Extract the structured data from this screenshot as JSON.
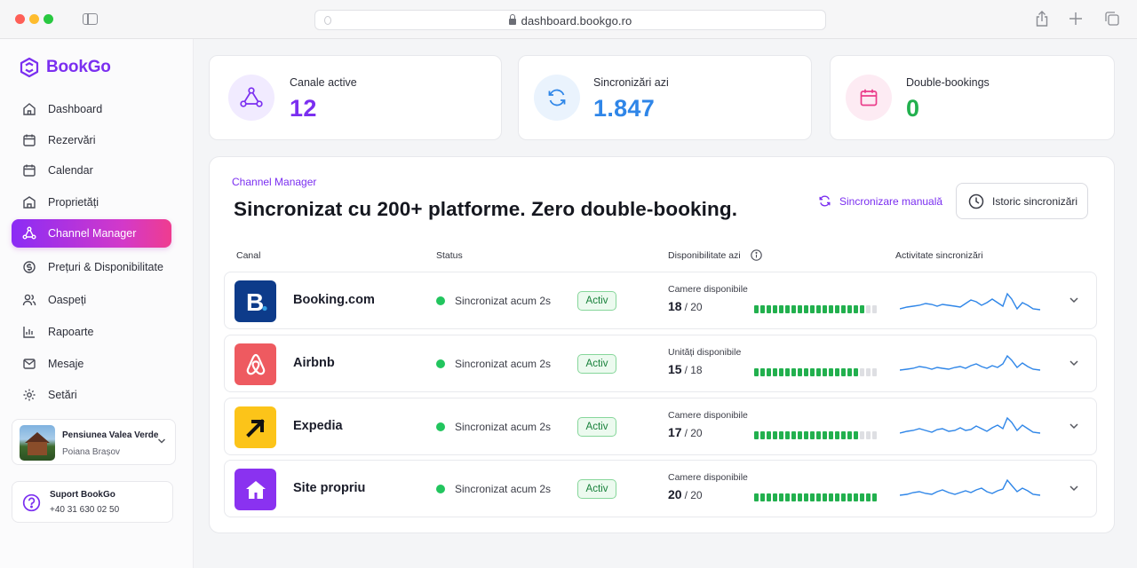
{
  "browser": {
    "url": "dashboard.bookgo.ro"
  },
  "brand": {
    "name": "BookGo"
  },
  "sidebar": {
    "items": [
      {
        "label": "Dashboard",
        "icon": "home-icon",
        "active": false
      },
      {
        "label": "Rezervări",
        "icon": "calendar-icon",
        "active": false
      },
      {
        "label": "Calendar",
        "icon": "calendar-grid-icon",
        "active": false
      },
      {
        "label": "Proprietăți",
        "icon": "building-icon",
        "active": false
      },
      {
        "label": "Channel Manager",
        "icon": "share-nodes-icon",
        "active": true
      },
      {
        "label": "Prețuri & Disponibilitate",
        "icon": "price-tag-icon",
        "active": false
      },
      {
        "label": "Oaspeți",
        "icon": "users-icon",
        "active": false
      },
      {
        "label": "Rapoarte",
        "icon": "bar-chart-icon",
        "active": false
      },
      {
        "label": "Mesaje",
        "icon": "mail-icon",
        "active": false
      },
      {
        "label": "Setări",
        "icon": "gear-icon",
        "active": false
      }
    ],
    "property": {
      "name": "Pensiunea Valea Verde",
      "location": "Poiana Brașov"
    },
    "support": {
      "title": "Suport BookGo",
      "phone": "+40 31 630 02 50"
    }
  },
  "stats": [
    {
      "label": "Canale active",
      "value": "12",
      "color": "#7b2ff0",
      "icon": "network-icon"
    },
    {
      "label": "Sincronizări azi",
      "value": "1.847",
      "color": "#2f86e8",
      "icon": "sync-icon"
    },
    {
      "label": "Double-bookings",
      "value": "0",
      "color": "#22b04e",
      "icon": "calendar-icon"
    }
  ],
  "panel": {
    "eyebrow": "Channel Manager",
    "headline": "Sincronizat cu 200+ platforme. Zero double-booking.",
    "sync_label": "Sincronizare manuală",
    "history_label": "Istoric sincronizări",
    "columns": {
      "channel": "Canal",
      "status": "Status",
      "availability": "Disponibilitate azi",
      "activity": "Activitate sincronizări"
    },
    "rows": [
      {
        "name": "Booking.com",
        "status": "Sincronizat acum 2s",
        "badge": "Activ",
        "avail_label": "Camere disponibile",
        "available": "18",
        "total": "/ 20",
        "fill": 0.9,
        "logo": "booking-logo-icon"
      },
      {
        "name": "Airbnb",
        "status": "Sincronizat acum 2s",
        "badge": "Activ",
        "avail_label": "Unități disponibile",
        "available": "15",
        "total": "/ 18",
        "fill": 0.83,
        "logo": "airbnb-logo-icon"
      },
      {
        "name": "Expedia",
        "status": "Sincronizat acum 2s",
        "badge": "Activ",
        "avail_label": "Camere disponibile",
        "available": "17",
        "total": "/ 20",
        "fill": 0.85,
        "logo": "expedia-logo-icon"
      },
      {
        "name": "Site propriu",
        "status": "Sincronizat acum 2s",
        "badge": "Activ",
        "avail_label": "Camere disponibile",
        "available": "20",
        "total": "/ 20",
        "fill": 1.0,
        "logo": "home-logo-icon"
      }
    ]
  },
  "colors": {
    "accent": "#7b2ff0",
    "pink": "#ef3c8f",
    "green": "#22b04e",
    "blue": "#2f86e8"
  }
}
